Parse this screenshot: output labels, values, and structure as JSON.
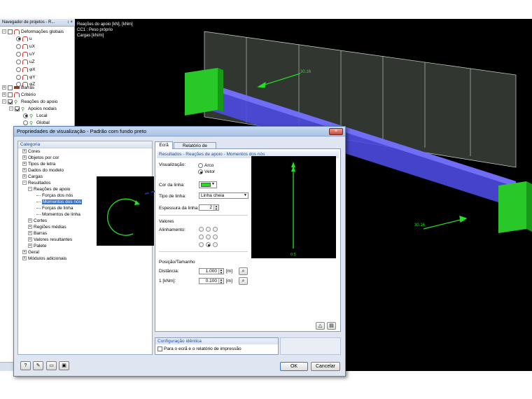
{
  "navigator": {
    "title": "Navegador de projetos - R...",
    "controls": "↕ ×",
    "items": [
      {
        "label": "Deformações globais"
      },
      {
        "label": "u"
      },
      {
        "label": "uX"
      },
      {
        "label": "uY"
      },
      {
        "label": "uZ"
      },
      {
        "label": "φX"
      },
      {
        "label": "φY"
      },
      {
        "label": "φZ"
      },
      {
        "label": "Barras"
      },
      {
        "label": "Critério"
      },
      {
        "label": "Reações do apoio"
      },
      {
        "label": "Apoios nodais"
      },
      {
        "label": "Local"
      },
      {
        "label": "Global"
      }
    ]
  },
  "viewport": {
    "info_lines": [
      "Reações do apoio [kN], [kNm]",
      "CC1 : Peso próprio",
      "Cargas [kN/m]"
    ],
    "labels": [
      "30.16",
      "30.16"
    ]
  },
  "dialog": {
    "title": "Propriedades de visualização - Padrão com fundo preto",
    "close_glyph": "×",
    "category_header": "Categoria",
    "category_items": [
      {
        "label": "Cores"
      },
      {
        "label": "Objetos por cor"
      },
      {
        "label": "Tipos de letra"
      },
      {
        "label": "Dados do modelo"
      },
      {
        "label": "Cargas"
      },
      {
        "label": "Resultados"
      },
      {
        "label": "Reações de apoio"
      },
      {
        "label": "Forças dos nós"
      },
      {
        "label": "Momentos dos nós"
      },
      {
        "label": "Forças de linha"
      },
      {
        "label": "Momentos de linha"
      },
      {
        "label": "Cortes"
      },
      {
        "label": "Regiões médias"
      },
      {
        "label": "Barras"
      },
      {
        "label": "Valores resultantes"
      },
      {
        "label": "Palete"
      },
      {
        "label": "Geral"
      },
      {
        "label": "Módulos adicionais"
      }
    ],
    "tabs": [
      {
        "label": "Ecrã"
      },
      {
        "label": "Relatório de impressão"
      }
    ],
    "section_title": "Resultados - Reações de apoio - Momentos dos nós",
    "visualization": {
      "label": "Visualização:",
      "options": [
        "Arco",
        "Vetor"
      ],
      "selected": "Vetor"
    },
    "line_color": {
      "label": "Cor da linha:",
      "value": "#22e022"
    },
    "line_type": {
      "label": "Tipo de linha:",
      "value": "Linha cheia"
    },
    "line_thickness": {
      "label": "Espessura da linha:",
      "value": "2"
    },
    "values_group": {
      "title": "Valores",
      "alignment_label": "Alinhamento:",
      "selected_index": 7
    },
    "position_group": {
      "title": "Posição/Tamanho",
      "distance_label": "Distância:",
      "distance_value": "1.000",
      "distance_unit": "[m]",
      "scale_label": "1  [kNm]:",
      "scale_value": "0.100",
      "scale_unit": "[m]"
    },
    "identical_config": {
      "title": "Configuração idêntica",
      "checkbox_label": "Para o ecrã e o relatório de impressão"
    },
    "preview_label_small": "0.5",
    "ok_label": "OK",
    "cancel_label": "Cancelar"
  }
}
